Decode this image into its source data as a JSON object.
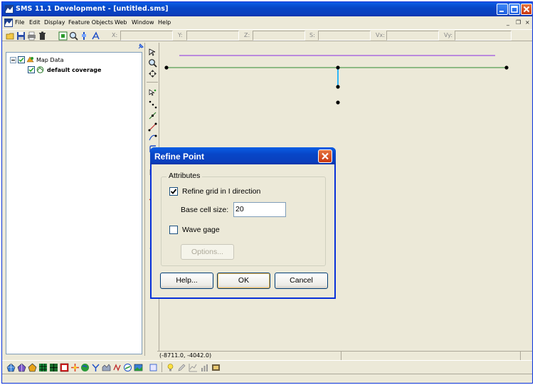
{
  "window": {
    "title": "SMS 11.1 Development - [untitled.sms]"
  },
  "menu": {
    "items": [
      "File",
      "Edit",
      "Display",
      "Feature Objects",
      "Web",
      "Window",
      "Help"
    ],
    "mdi_minimize": "_",
    "mdi_restore": "❐",
    "mdi_close": "×"
  },
  "coords": {
    "labels": [
      "X:",
      "Y:",
      "Z:",
      "S:",
      "Vx:",
      "Vy:"
    ],
    "values": [
      "",
      "",
      "",
      "",
      "",
      ""
    ]
  },
  "explorer": {
    "root_label": "Map Data",
    "child_label": "default coverage",
    "root_checked": true,
    "child_checked": true
  },
  "status": {
    "cursor": "(-8711.0, -4042.0)"
  },
  "dialog": {
    "title": "Refine Point",
    "group_label": "Attributes",
    "refine_label": "Refine grid in I direction",
    "refine_checked": true,
    "base_cell_label": "Base cell size:",
    "base_cell_value": "20",
    "wave_gage_label": "Wave gage",
    "wave_gage_checked": false,
    "options_label": "Options...",
    "help_label": "Help...",
    "ok_label": "OK",
    "cancel_label": "Cancel"
  },
  "colors": {
    "arc_main": "#2f8a2f",
    "arc_purple": "#8a2be2",
    "arc_connector": "#00aaff",
    "node": "#000000",
    "title_blue": "#0a4fd6"
  },
  "icons": {
    "toolbar": [
      "open-icon",
      "save-icon",
      "print-icon",
      "delete-icon",
      "frame-icon",
      "zoom-icon",
      "rotate-icon",
      "measure-icon"
    ],
    "palette": [
      "select-tool-icon",
      "zoom-tool-icon",
      "pan-tool-icon",
      "select-feature-icon",
      "create-point-icon",
      "select-point-icon",
      "create-node-icon",
      "select-node-icon",
      "create-arc-icon",
      "select-arc-icon"
    ],
    "bottom": [
      "mesh-module-icon",
      "grid-module-icon",
      "scatter-module-icon",
      "cgrid-module-icon",
      "raster-module-icon",
      "map-module-icon",
      "particle-module-icon",
      "gis-module-icon",
      "tin-module-icon",
      "stamping-module-icon",
      "animation-module-icon",
      "contour-icon",
      "image-icon",
      "lightbulb-icon",
      "edit-icon",
      "plot-icon",
      "film-icon"
    ]
  }
}
